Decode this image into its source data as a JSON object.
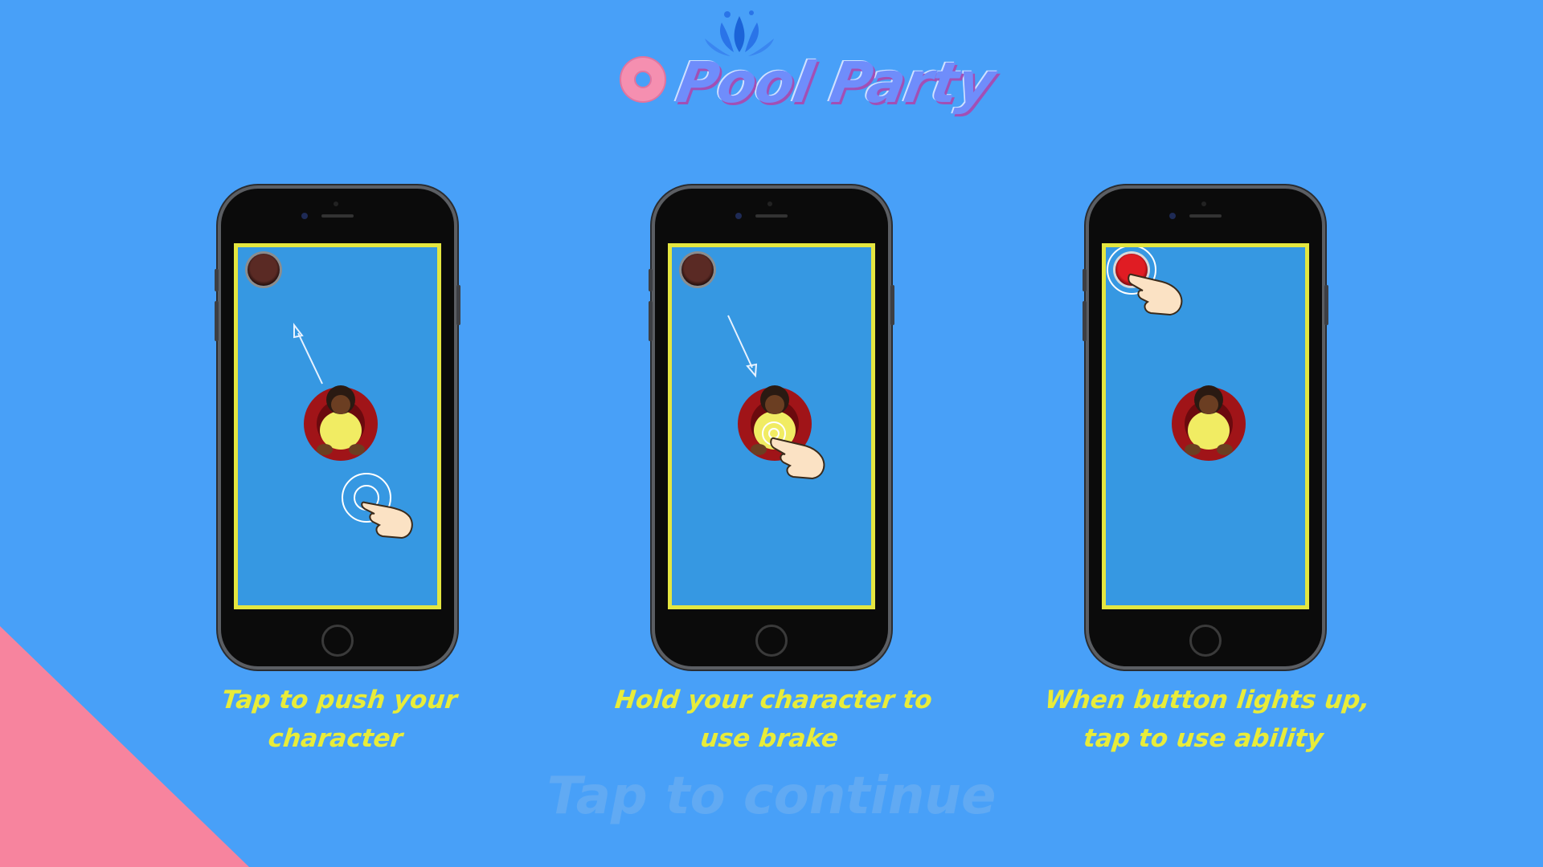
{
  "logo": {
    "title": "Pool Party"
  },
  "tutorial": [
    {
      "caption": "Tap to push your character",
      "gesture": "swipe-push",
      "button_lit": false
    },
    {
      "caption": "Hold your character to use brake",
      "gesture": "hold-brake",
      "button_lit": false
    },
    {
      "caption": "When button lights up, tap to use ability",
      "gesture": "tap-ability",
      "button_lit": true
    }
  ],
  "prompt": {
    "continue_label": "Tap to continue"
  },
  "colors": {
    "background": "#48a0f8",
    "corner_accent": "#f7849e",
    "screen_border": "#e4e640",
    "caption": "#e8ec3a",
    "ability_lit": "#e01c23"
  }
}
